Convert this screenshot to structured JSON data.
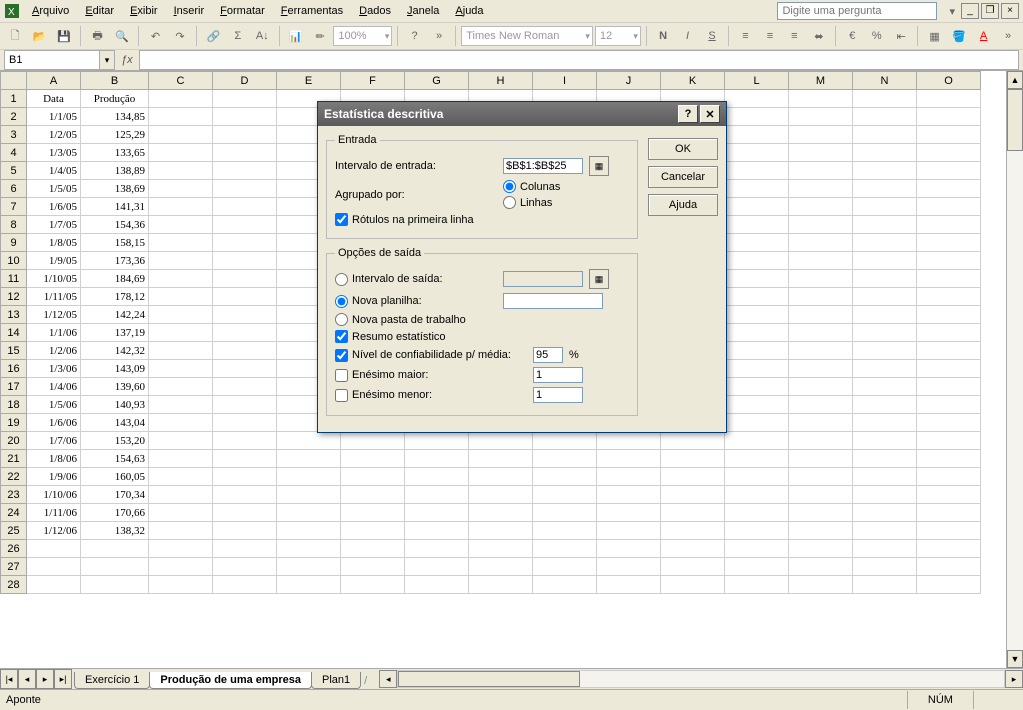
{
  "menu": {
    "items": [
      "Arquivo",
      "Editar",
      "Exibir",
      "Inserir",
      "Formatar",
      "Ferramentas",
      "Dados",
      "Janela",
      "Ajuda"
    ],
    "askbox_placeholder": "Digite uma pergunta"
  },
  "toolbar": {
    "font": "Times New Roman",
    "size": "12",
    "zoom": "100%"
  },
  "namebox": "B1",
  "columns": [
    "A",
    "B",
    "C",
    "D",
    "E",
    "F",
    "G",
    "H",
    "I",
    "J",
    "K",
    "L",
    "M",
    "N",
    "O"
  ],
  "headers": {
    "A": "Data",
    "B": "Produção"
  },
  "rows": [
    {
      "n": 1
    },
    {
      "n": 2,
      "A": "1/1/05",
      "B": "134,85"
    },
    {
      "n": 3,
      "A": "1/2/05",
      "B": "125,29"
    },
    {
      "n": 4,
      "A": "1/3/05",
      "B": "133,65"
    },
    {
      "n": 5,
      "A": "1/4/05",
      "B": "138,89"
    },
    {
      "n": 6,
      "A": "1/5/05",
      "B": "138,69"
    },
    {
      "n": 7,
      "A": "1/6/05",
      "B": "141,31"
    },
    {
      "n": 8,
      "A": "1/7/05",
      "B": "154,36"
    },
    {
      "n": 9,
      "A": "1/8/05",
      "B": "158,15"
    },
    {
      "n": 10,
      "A": "1/9/05",
      "B": "173,36"
    },
    {
      "n": 11,
      "A": "1/10/05",
      "B": "184,69"
    },
    {
      "n": 12,
      "A": "1/11/05",
      "B": "178,12"
    },
    {
      "n": 13,
      "A": "1/12/05",
      "B": "142,24"
    },
    {
      "n": 14,
      "A": "1/1/06",
      "B": "137,19"
    },
    {
      "n": 15,
      "A": "1/2/06",
      "B": "142,32"
    },
    {
      "n": 16,
      "A": "1/3/06",
      "B": "143,09"
    },
    {
      "n": 17,
      "A": "1/4/06",
      "B": "139,60"
    },
    {
      "n": 18,
      "A": "1/5/06",
      "B": "140,93"
    },
    {
      "n": 19,
      "A": "1/6/06",
      "B": "143,04"
    },
    {
      "n": 20,
      "A": "1/7/06",
      "B": "153,20"
    },
    {
      "n": 21,
      "A": "1/8/06",
      "B": "154,63"
    },
    {
      "n": 22,
      "A": "1/9/06",
      "B": "160,05"
    },
    {
      "n": 23,
      "A": "1/10/06",
      "B": "170,34"
    },
    {
      "n": 24,
      "A": "1/11/06",
      "B": "170,66"
    },
    {
      "n": 25,
      "A": "1/12/06",
      "B": "138,32"
    },
    {
      "n": 26
    },
    {
      "n": 27
    },
    {
      "n": 28
    }
  ],
  "sheets": {
    "tabs": [
      "Exercício 1",
      "Produção de uma empresa",
      "Plan1"
    ],
    "active": 1
  },
  "status": {
    "left": "Aponte",
    "num": "NÚM"
  },
  "dialog": {
    "title": "Estatística descritiva",
    "entrada_legend": "Entrada",
    "intervalo_entrada_lbl": "Intervalo de entrada:",
    "intervalo_entrada_val": "$B$1:$B$25",
    "agrupado_lbl": "Agrupado por:",
    "colunas_lbl": "Colunas",
    "linhas_lbl": "Linhas",
    "rotulos_lbl": "Rótulos na primeira linha",
    "saida_legend": "Opções de saída",
    "intervalo_saida_lbl": "Intervalo de saída:",
    "nova_planilha_lbl": "Nova planilha:",
    "nova_pasta_lbl": "Nova pasta de trabalho",
    "resumo_lbl": "Resumo estatístico",
    "confianca_lbl": "Nível de confiabilidade p/ média:",
    "confianca_val": "95",
    "pct": "%",
    "maior_lbl": "Enésimo maior:",
    "maior_val": "1",
    "menor_lbl": "Enésimo menor:",
    "menor_val": "1",
    "ok": "OK",
    "cancel": "Cancelar",
    "help": "Ajuda"
  }
}
